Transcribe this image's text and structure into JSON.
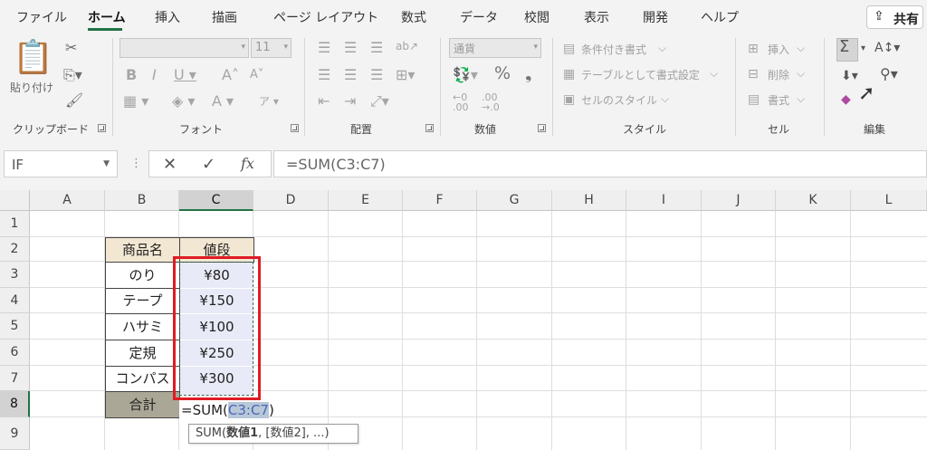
{
  "menu": {
    "tabs": [
      "ファイル",
      "ホーム",
      "挿入",
      "描画",
      "ページ レイアウト",
      "数式",
      "データ",
      "校閲",
      "表示",
      "開発",
      "ヘルプ"
    ],
    "active_tab": "ホーム",
    "share_label": "共有"
  },
  "ribbon": {
    "clipboard": {
      "paste_label": "貼り付け",
      "group_label": "クリップボード"
    },
    "font": {
      "font_name": "",
      "font_size": "11",
      "group_label": "フォント"
    },
    "alignment": {
      "group_label": "配置"
    },
    "number": {
      "format_value": "通貨",
      "group_label": "数値"
    },
    "styles": {
      "conditional_formatting": "条件付き書式",
      "format_as_table": "テーブルとして書式設定",
      "cell_styles": "セルのスタイル",
      "group_label": "スタイル"
    },
    "cells": {
      "insert": "挿入",
      "delete": "削除",
      "format": "書式",
      "group_label": "セル"
    },
    "editing": {
      "group_label": "編集"
    }
  },
  "formula_bar": {
    "name_box": "IF",
    "formula": "=SUM(C3:C7)"
  },
  "columns": [
    "A",
    "B",
    "C",
    "D",
    "E",
    "F",
    "G",
    "H",
    "I",
    "J",
    "K",
    "L"
  ],
  "rows": [
    "1",
    "2",
    "3",
    "4",
    "5",
    "6",
    "7",
    "8",
    "9"
  ],
  "table": {
    "headers": {
      "name": "商品名",
      "price": "値段"
    },
    "rows": [
      {
        "name": "のり",
        "price": "¥80"
      },
      {
        "name": "テープ",
        "price": "¥150"
      },
      {
        "name": "ハサミ",
        "price": "¥100"
      },
      {
        "name": "定規",
        "price": "¥250"
      },
      {
        "name": "コンパス",
        "price": "¥300"
      }
    ],
    "total_label": "合計"
  },
  "editing_cell": {
    "prefix": "=SUM(",
    "range": "C3:C7",
    "suffix": ")"
  },
  "tooltip": {
    "prefix": "SUM(",
    "arg1": "数値1",
    "rest": ", [数値2], ...)"
  },
  "colors": {
    "accent": "#217346",
    "highlight_red": "#e01b24",
    "header_fill": "#f2e7d2",
    "total_fill": "#aba796",
    "range_fill": "#e8eaf7"
  }
}
